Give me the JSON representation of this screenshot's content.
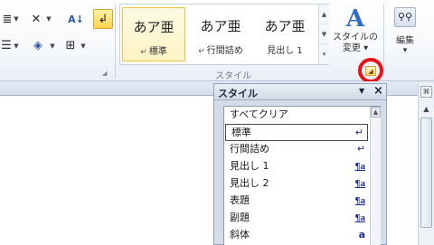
{
  "ribbon": {
    "font_group_icons": [
      "strikethrough-x-icon",
      "sort-az-icon",
      "show-formatting-icon",
      "list-icon",
      "shading-icon",
      "border-icon"
    ],
    "gallery_items": [
      {
        "sample": "あア亜",
        "name": "標準",
        "mark": "↵"
      },
      {
        "sample": "あア亜",
        "name": "行間詰め",
        "mark": "↵"
      },
      {
        "sample": "あア亜",
        "name": "見出し 1",
        "mark": ""
      }
    ],
    "styles_group_label": "スタイル",
    "change_style_label_1": "スタイルの",
    "change_style_label_2": "変更",
    "change_style_dropdown": "▾",
    "edit_label": "編集",
    "edit_dropdown": "▾"
  },
  "pane": {
    "title": "スタイル",
    "items": [
      {
        "label": "すべてクリア",
        "mark": ""
      },
      {
        "label": "標準",
        "mark": "↵"
      },
      {
        "label": "行間詰め",
        "mark": "↵"
      },
      {
        "label": "見出し 1",
        "mark": "¶a"
      },
      {
        "label": "見出し 2",
        "mark": "¶a"
      },
      {
        "label": "表題",
        "mark": "¶a"
      },
      {
        "label": "副題",
        "mark": "¶a"
      },
      {
        "label": "斜体",
        "mark": "a"
      }
    ]
  },
  "colors": {
    "accent_highlight": "#ffd44d",
    "red_circle": "#e4141b",
    "style_mark_blue": "#1a2f9c"
  }
}
